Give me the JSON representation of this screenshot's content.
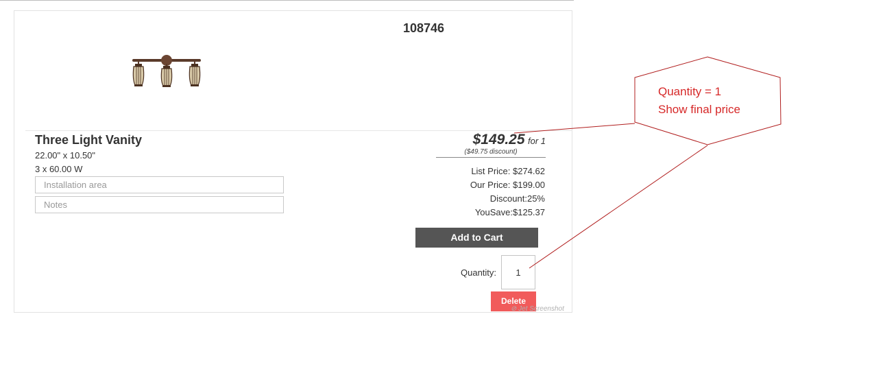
{
  "product": {
    "id": "108746",
    "title": "Three Light Vanity",
    "dimensions": "22.00\" x 10.50\"",
    "wattage": "3 x 60.00 W",
    "image_icon": "vanity-light-fixture-icon"
  },
  "fields": {
    "installation_placeholder": "Installation area",
    "installation_value": "",
    "notes_placeholder": "Notes",
    "notes_value": ""
  },
  "pricing": {
    "final_price": "$149.25",
    "for_qty": "for 1",
    "discount_note": "($49.75 discount)",
    "list_price": "List Price: $274.62",
    "our_price": "Our Price: $199.00",
    "discount": "Discount:25%",
    "you_save": "YouSave:$125.37"
  },
  "actions": {
    "add_to_cart": "Add to Cart",
    "quantity_label": "Quantity:",
    "quantity_value": "1",
    "delete": "Delete"
  },
  "annotation": {
    "line1": "Quantity = 1",
    "line2": "Show final price",
    "color": "#d62828"
  },
  "colors": {
    "add_to_cart_bg": "#555555",
    "delete_bg": "#f15b5b"
  }
}
